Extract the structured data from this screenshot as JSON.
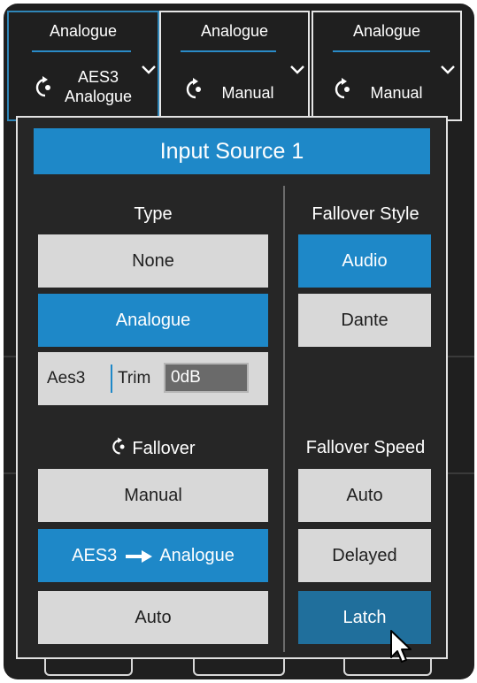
{
  "channels": [
    {
      "label": "Analogue",
      "mode_lines": [
        "AES3",
        "Analogue"
      ]
    },
    {
      "label": "Analogue",
      "mode_lines": [
        "Manual"
      ]
    },
    {
      "label": "Analogue",
      "mode_lines": [
        "Manual"
      ]
    }
  ],
  "panel": {
    "title": "Input Source 1",
    "type": {
      "heading": "Type",
      "options": [
        "None",
        "Analogue"
      ],
      "selected": "Analogue",
      "aes": {
        "label": "Aes3",
        "trim_label": "Trim",
        "trim_value": "0dB"
      }
    },
    "fallover": {
      "heading": "Fallover",
      "options": {
        "manual": "Manual",
        "aes_from": "AES3",
        "aes_to": "Analogue",
        "auto": "Auto"
      },
      "selected": "AES3 → Analogue"
    },
    "fallover_style": {
      "heading": "Fallover Style",
      "options": [
        "Audio",
        "Dante"
      ],
      "selected": "Audio"
    },
    "fallover_speed": {
      "heading": "Fallover Speed",
      "options": [
        "Auto",
        "Delayed",
        "Latch"
      ],
      "hovered": "Latch"
    }
  },
  "colors": {
    "accent": "#1e88c8",
    "panel_bg": "#262626",
    "button_light": "#d8d8d8"
  },
  "icons": [
    "fallover-icon",
    "chevron-down-icon",
    "right-arrow-icon",
    "mouse-cursor-icon"
  ]
}
